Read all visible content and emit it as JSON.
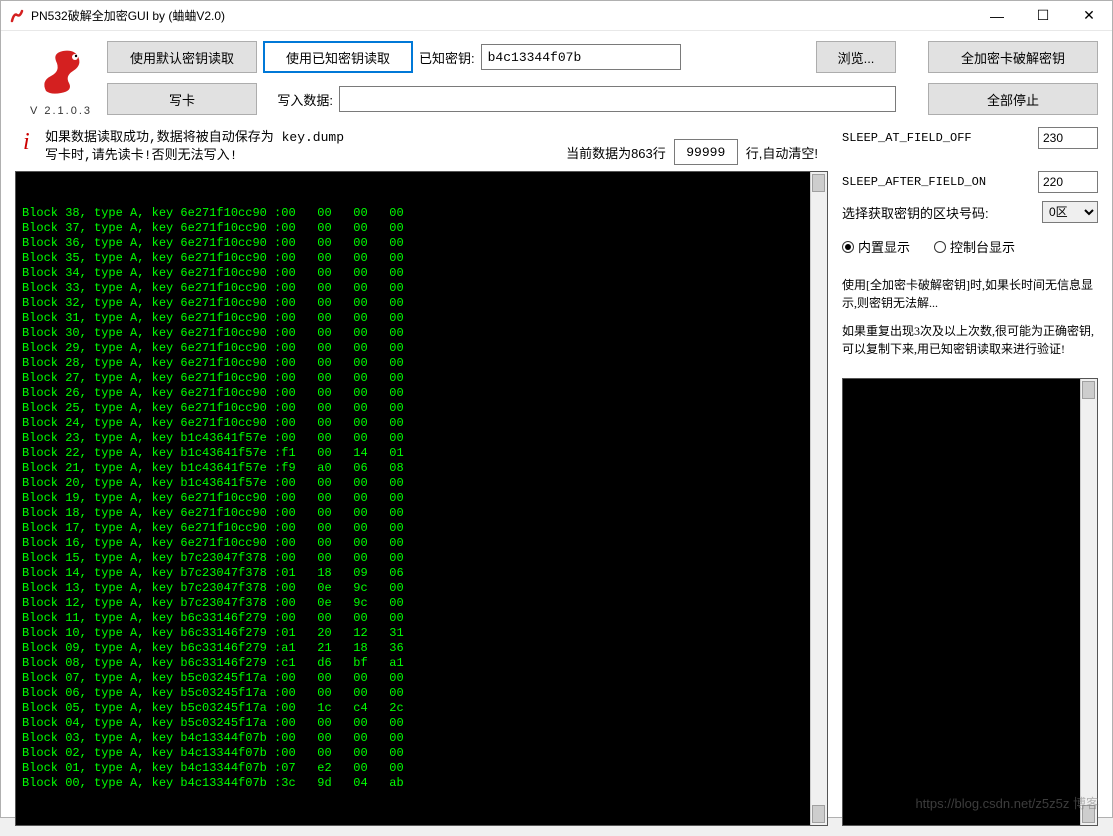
{
  "window": {
    "title": "PN532破解全加密GUI by (蛐蛐V2.0)"
  },
  "version": "V 2.1.0.3",
  "toolbar": {
    "read_default_key": "使用默认密钥读取",
    "read_known_key": "使用已知密钥读取",
    "known_key_label": "已知密钥:",
    "known_key_value": "b4c13344f07b",
    "browse": "浏览...",
    "crack_all": "全加密卡破解密钥",
    "write_card": "写卡",
    "write_data_label": "写入数据:",
    "write_data_value": "",
    "stop_all": "全部停止"
  },
  "status": {
    "line1": "如果数据读取成功,数据将被自动保存为 key.dump",
    "line2": "写卡时,请先读卡!否则无法写入!"
  },
  "info": {
    "current_data_label": "当前数据为863行",
    "line_count_value": "99999",
    "auto_clear_label": "行,自动清空!"
  },
  "settings": {
    "sleep_off_label": "SLEEP_AT_FIELD_OFF",
    "sleep_off_value": "230",
    "sleep_on_label": "SLEEP_AFTER_FIELD_ON",
    "sleep_on_value": "220",
    "block_select_label": "选择获取密钥的区块号码:",
    "block_select_value": "0区",
    "radio_internal": "内置显示",
    "radio_console": "控制台显示"
  },
  "help": {
    "p1": "使用[全加密卡破解密钥]时,如果长时间无信息显示,则密钥无法解...",
    "p2": "如果重复出现3次及以上次数,很可能为正确密钥,可以复制下来,用已知密钥读取来进行验证!"
  },
  "console_lines": [
    "Block 38, type A, key 6e271f10cc90 :00   00   00   00",
    "Block 37, type A, key 6e271f10cc90 :00   00   00   00",
    "Block 36, type A, key 6e271f10cc90 :00   00   00   00",
    "Block 35, type A, key 6e271f10cc90 :00   00   00   00",
    "Block 34, type A, key 6e271f10cc90 :00   00   00   00",
    "Block 33, type A, key 6e271f10cc90 :00   00   00   00",
    "Block 32, type A, key 6e271f10cc90 :00   00   00   00",
    "Block 31, type A, key 6e271f10cc90 :00   00   00   00",
    "Block 30, type A, key 6e271f10cc90 :00   00   00   00",
    "Block 29, type A, key 6e271f10cc90 :00   00   00   00",
    "Block 28, type A, key 6e271f10cc90 :00   00   00   00",
    "Block 27, type A, key 6e271f10cc90 :00   00   00   00",
    "Block 26, type A, key 6e271f10cc90 :00   00   00   00",
    "Block 25, type A, key 6e271f10cc90 :00   00   00   00",
    "Block 24, type A, key 6e271f10cc90 :00   00   00   00",
    "Block 23, type A, key b1c43641f57e :00   00   00   00",
    "Block 22, type A, key b1c43641f57e :f1   00   14   01",
    "Block 21, type A, key b1c43641f57e :f9   a0   06   08",
    "Block 20, type A, key b1c43641f57e :00   00   00   00",
    "Block 19, type A, key 6e271f10cc90 :00   00   00   00",
    "Block 18, type A, key 6e271f10cc90 :00   00   00   00",
    "Block 17, type A, key 6e271f10cc90 :00   00   00   00",
    "Block 16, type A, key 6e271f10cc90 :00   00   00   00",
    "Block 15, type A, key b7c23047f378 :00   00   00   00",
    "Block 14, type A, key b7c23047f378 :01   18   09   06",
    "Block 13, type A, key b7c23047f378 :00   0e   9c   00",
    "Block 12, type A, key b7c23047f378 :00   0e   9c   00",
    "Block 11, type A, key b6c33146f279 :00   00   00   00",
    "Block 10, type A, key b6c33146f279 :01   20   12   31",
    "Block 09, type A, key b6c33146f279 :a1   21   18   36",
    "Block 08, type A, key b6c33146f279 :c1   d6   bf   a1",
    "Block 07, type A, key b5c03245f17a :00   00   00   00",
    "Block 06, type A, key b5c03245f17a :00   00   00   00",
    "Block 05, type A, key b5c03245f17a :00   1c   c4   2c",
    "Block 04, type A, key b5c03245f17a :00   00   00   00",
    "Block 03, type A, key b4c13344f07b :00   00   00   00",
    "Block 02, type A, key b4c13344f07b :00   00   00   00",
    "Block 01, type A, key b4c13344f07b :07   e2   00   00",
    "Block 00, type A, key b4c13344f07b :3c   9d   04   ab"
  ],
  "watermark": "https://blog.csdn.net/z5z5z 博客"
}
